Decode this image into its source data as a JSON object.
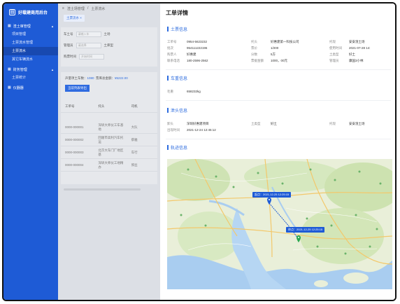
{
  "app": {
    "title": "好载建商用后台",
    "logo_glyph": "回"
  },
  "sidebar": {
    "groups": [
      {
        "label": "渣土审管理",
        "items": [
          "项目管理",
          "土票流水管理",
          "土票流水",
          "其它车辆流水"
        ]
      },
      {
        "label": "财务管理",
        "items": [
          "土票统计"
        ]
      },
      {
        "label": "仪器器",
        "items": []
      }
    ],
    "active_item": "土票流水"
  },
  "underlay": {
    "breadcrumb": [
      "渣土场管理",
      "土票流水"
    ],
    "tab": "土票流水",
    "filters": [
      {
        "label": "车土号",
        "placeholder": "请输入车"
      },
      {
        "label": "土场",
        "placeholder": "请选择"
      },
      {
        "label": "管理员",
        "placeholder": "请选择"
      },
      {
        "label": "土库型",
        "placeholder": "请选择"
      },
      {
        "label": "购票时间",
        "placeholder": "开始时间"
      }
    ],
    "summary": {
      "count_label": "声量项土车数：",
      "count": "1080",
      "amount_label": "票库总金额：",
      "amount": "¥5222.00"
    },
    "export_label": "当前列表导出",
    "columns": [
      "工单号",
      "托头",
      "司机"
    ],
    "rows": [
      [
        "0000-000001",
        "深圳大师仪工车基地",
        "大队"
      ],
      [
        "0000-000002",
        "回顺市高利汽车托运",
        "蔡雅"
      ],
      [
        "0000-000003",
        "北京大车门厂地区基",
        "车行"
      ],
      [
        "0000-000004",
        "深圳大师仪工地精办",
        "郭丝"
      ]
    ]
  },
  "panel": {
    "title": "工单详情",
    "sections": {
      "ticket": "土票信息",
      "vehicle": "车重信息",
      "dump": "泄头信息",
      "track": "轨迹信息"
    },
    "ticket_info": [
      {
        "k": "工单号",
        "v": "0954-5623232"
      },
      {
        "k": "托头",
        "v": "好惠建第一科技公司"
      },
      {
        "k": "托现",
        "v": "安安渣土场"
      },
      {
        "k": "批次",
        "v": "954111222196"
      },
      {
        "k": "票价",
        "v": "1/200"
      },
      {
        "k": "使用时间",
        "v": "2021-07-28 14:"
      },
      {
        "k": "购票人",
        "v": "好惠建"
      },
      {
        "k": "分数",
        "v": "5方"
      },
      {
        "k": "土类型",
        "v": "好土"
      },
      {
        "k": "联系电话",
        "v": "180-2596-2562"
      },
      {
        "k": "票据金额",
        "v": "1000，00元"
      },
      {
        "k": "管理员",
        "v": "康国3小林"
      }
    ],
    "vehicle_info": [
      {
        "k": "毛重",
        "v": "658232kg"
      }
    ],
    "dump_info": [
      {
        "k": "卸头",
        "v": "深圳好惠建项目"
      },
      {
        "k": "土类型",
        "v": "好土"
      },
      {
        "k": "托现",
        "v": "安安渣土场"
      },
      {
        "k": "出现时间",
        "v": "2021-12-24  12:45:12"
      }
    ],
    "map": {
      "label_start": "起点：2021-12-25  12:25:15",
      "label_end": "终点：2021-12-25  12:25:15",
      "accent": "#1e5bd6"
    }
  }
}
